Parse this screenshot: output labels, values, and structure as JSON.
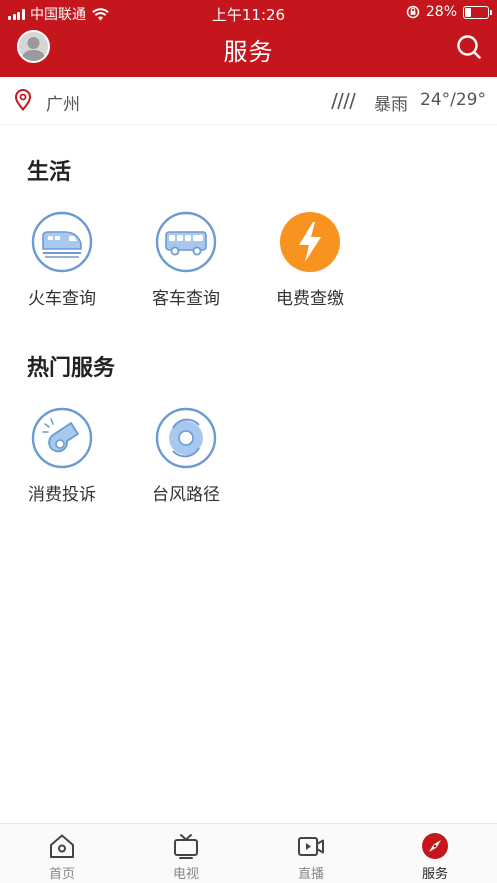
{
  "status_bar": {
    "carrier": "中国联通",
    "time": "上午11:26",
    "battery_percent": "28%",
    "battery_level": 0.28,
    "icons": [
      "signal-icon",
      "wifi-icon",
      "orientation-lock-icon",
      "battery-icon"
    ]
  },
  "header": {
    "title": "服务",
    "left_icon": "avatar",
    "right_icon": "search-icon",
    "background_color": "#c4161c"
  },
  "location": {
    "city": "广州",
    "weather": "暴雨",
    "temperature": "24°/29°",
    "icons": [
      "location-pin-icon",
      "rain-icon"
    ]
  },
  "sections": [
    {
      "title": "生活",
      "items": [
        {
          "label": "火车查询",
          "icon": "train-icon"
        },
        {
          "label": "客车查询",
          "icon": "bus-icon"
        },
        {
          "label": "电费查缴",
          "icon": "lightning-icon"
        }
      ]
    },
    {
      "title": "热门服务",
      "items": [
        {
          "label": "消费投诉",
          "icon": "whistle-icon"
        },
        {
          "label": "台风路径",
          "icon": "typhoon-icon"
        }
      ]
    }
  ],
  "tabbar": {
    "tabs": [
      {
        "label": "首页",
        "icon": "home-icon",
        "active": false
      },
      {
        "label": "电视",
        "icon": "tv-icon",
        "active": false
      },
      {
        "label": "直播",
        "icon": "video-icon",
        "active": false
      },
      {
        "label": "服务",
        "icon": "compass-icon",
        "active": true
      }
    ]
  },
  "colors": {
    "accent": "#c4161c",
    "icon_blue": "#6b9bd2",
    "icon_blue_fill": "#a9c8f0",
    "electric_orange": "#f7931e"
  }
}
